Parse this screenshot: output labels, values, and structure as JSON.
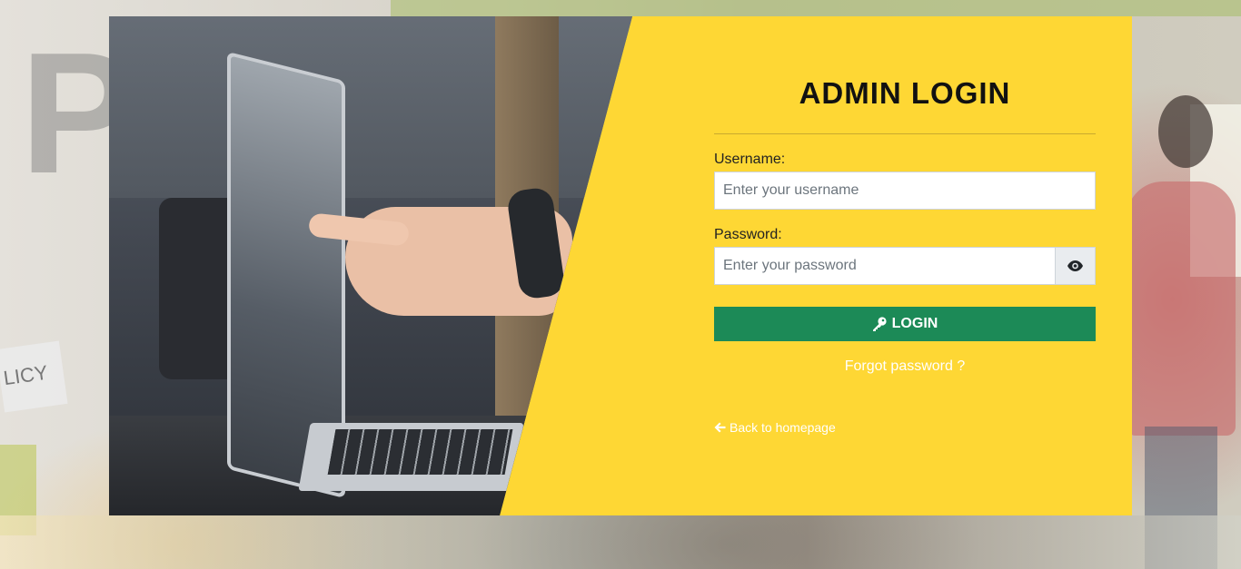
{
  "background": {
    "sign_letter": "P",
    "sign_text": "LICY"
  },
  "login": {
    "title": "ADMIN LOGIN",
    "username_label": "Username:",
    "username_placeholder": "Enter your username",
    "username_value": "",
    "password_label": "Password:",
    "password_placeholder": "Enter your password",
    "password_value": "",
    "toggle_icon": "eye-icon",
    "login_button_label": "LOGIN",
    "login_button_icon": "key-icon",
    "forgot_password_label": "Forgot password ?",
    "back_label": "Back to homepage",
    "back_icon": "arrow-left-icon"
  },
  "colors": {
    "panel": "#fed734",
    "button": "#1c8a57",
    "link": "#ffffff"
  }
}
